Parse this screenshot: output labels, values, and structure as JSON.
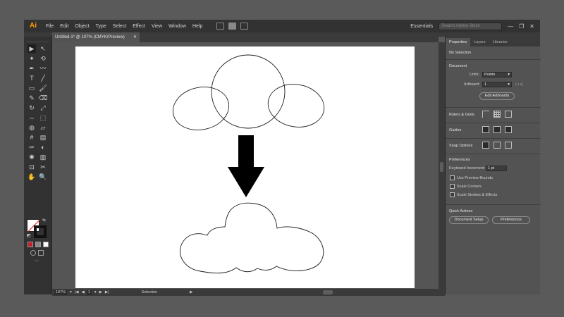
{
  "app": {
    "logo": "Ai"
  },
  "menu": [
    "File",
    "Edit",
    "Object",
    "Type",
    "Select",
    "Effect",
    "View",
    "Window",
    "Help"
  ],
  "workspace_label": "Essentials",
  "search": {
    "placeholder": "Search Adobe Stock"
  },
  "window_buttons": {
    "minimize": "—",
    "restore": "❐",
    "close": "✕"
  },
  "document_tab": {
    "title": "Untitled-1* @ 107% (CMYK/Preview)",
    "close": "✕"
  },
  "status": {
    "zoom": "107%",
    "artboard": "1",
    "tool": "Selection"
  },
  "panel": {
    "tabs": [
      "Properties",
      "Layers",
      "Libraries"
    ],
    "no_selection": "No Selection",
    "document_title": "Document",
    "units_label": "Units:",
    "units_value": "Points",
    "artboard_label": "Artboard:",
    "artboard_value": "1",
    "edit_artboards": "Edit Artboards",
    "rulers_grids": "Rulers & Grids",
    "guides": "Guides",
    "snap_options": "Snap Options",
    "preferences_title": "Preferences",
    "keyboard_increment_label": "Keyboard Increment:",
    "keyboard_increment_value": "1 pt",
    "checkboxes": [
      "Use Preview Bounds",
      "Scale Corners",
      "Scale Strokes & Effects"
    ],
    "quick_actions_title": "Quick Actions",
    "document_setup": "Document Setup",
    "preferences_button": "Preferences"
  },
  "icons": {
    "selection": "▶",
    "direct_selection": "↖",
    "magic_wand": "✦",
    "lasso": "⟲",
    "pen": "✒",
    "curvature": "〰",
    "type": "T",
    "line": "╱",
    "rectangle": "▭",
    "paintbrush": "🖌",
    "shaper": "✎",
    "eraser": "⌫",
    "rotate": "↻",
    "scale": "⤢",
    "width": "⇔",
    "free_transform": "⬚",
    "shape_builder": "◍",
    "perspective": "▱",
    "mesh": "#",
    "gradient": "▤",
    "eyedropper": "✑",
    "blend": "◐",
    "symbol_sprayer": "✺",
    "column_graph": "▥",
    "artboard": "⊡",
    "slice": "✂",
    "hand": "✋",
    "zoom": "🔍",
    "swap": "⇆",
    "default": "◩",
    "edit_toolbar": "⋯"
  },
  "colors": {
    "arrow": "#000000",
    "outline": "#1a1a1a",
    "fill_none_slash": "#e01f1f"
  }
}
